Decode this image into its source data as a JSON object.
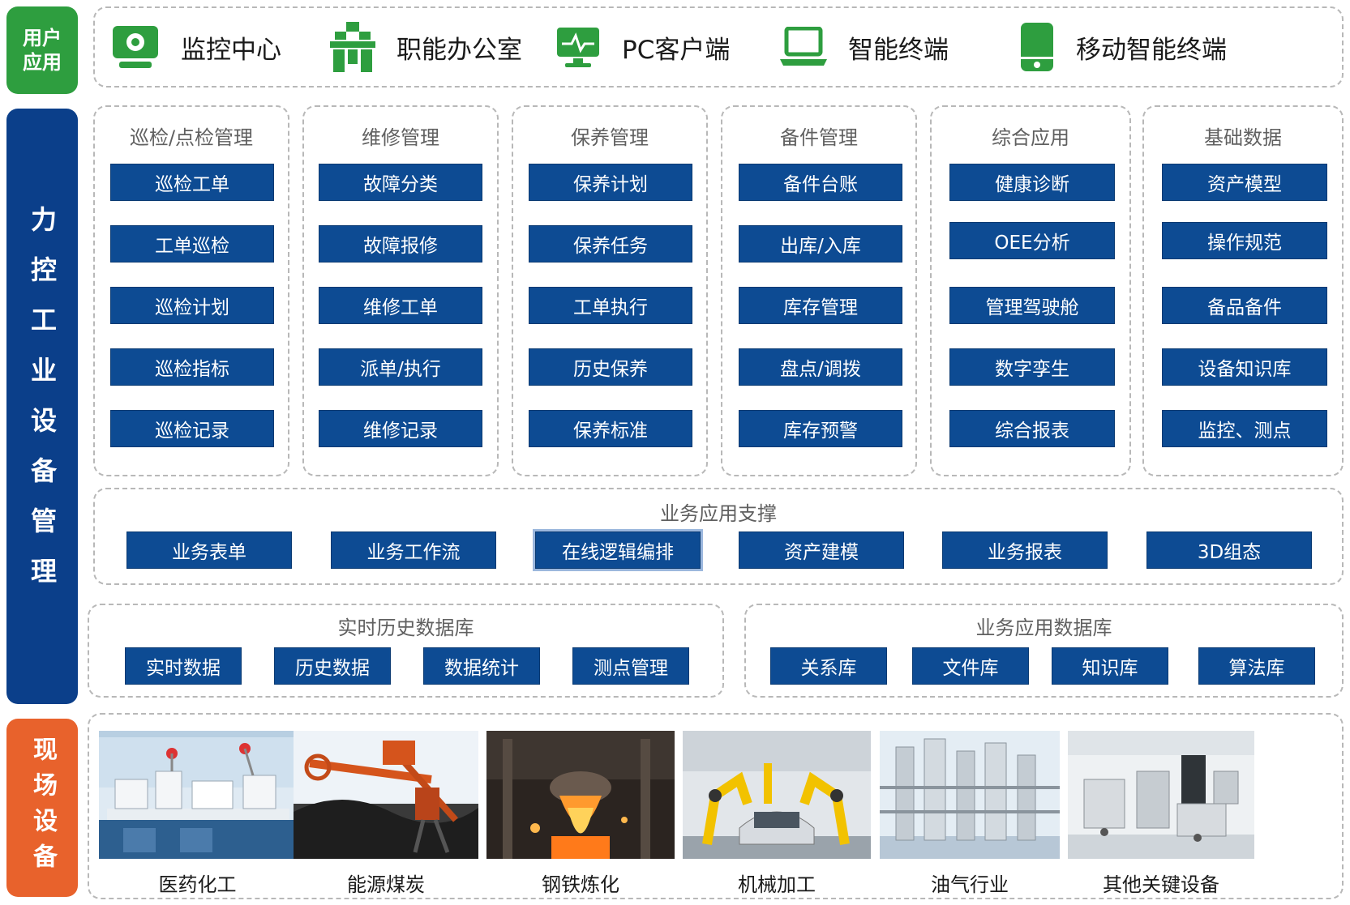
{
  "sections": {
    "user_app": "用户应用",
    "main": "力控工业设备管理",
    "field": "现场设备"
  },
  "top": [
    {
      "label": "监控中心",
      "icon": "monitor-center-icon"
    },
    {
      "label": "职能办公室",
      "icon": "office-icon"
    },
    {
      "label": "PC客户端",
      "icon": "pc-client-icon"
    },
    {
      "label": "智能终端",
      "icon": "laptop-icon"
    },
    {
      "label": "移动智能终端",
      "icon": "mobile-icon"
    }
  ],
  "modules": [
    {
      "title": "巡检/点检管理",
      "items": [
        "巡检工单",
        "工单巡检",
        "巡检计划",
        "巡检指标",
        "巡检记录"
      ]
    },
    {
      "title": "维修管理",
      "items": [
        "故障分类",
        "故障报修",
        "维修工单",
        "派单/执行",
        "维修记录"
      ]
    },
    {
      "title": "保养管理",
      "items": [
        "保养计划",
        "保养任务",
        "工单执行",
        "历史保养",
        "保养标准"
      ]
    },
    {
      "title": "备件管理",
      "items": [
        "备件台账",
        "出库/入库",
        "库存管理",
        "盘点/调拨",
        "库存预警"
      ]
    },
    {
      "title": "综合应用",
      "items": [
        "健康诊断",
        "OEE分析",
        "管理驾驶舱",
        "数字孪生",
        "综合报表"
      ]
    },
    {
      "title": "基础数据",
      "items": [
        "资产模型",
        "操作规范",
        "备品备件",
        "设备知识库",
        "监控、测点"
      ]
    }
  ],
  "support": {
    "title": "业务应用支撑",
    "items": [
      "业务表单",
      "业务工作流",
      "在线逻辑编排",
      "资产建模",
      "业务报表",
      "3D组态"
    ]
  },
  "realtime_db": {
    "title": "实时历史数据库",
    "items": [
      "实时数据",
      "历史数据",
      "数据统计",
      "测点管理"
    ]
  },
  "business_db": {
    "title": "业务应用数据库",
    "items": [
      "关系库",
      "文件库",
      "知识库",
      "算法库"
    ]
  },
  "industries": [
    "医药化工",
    "能源煤炭",
    "钢铁炼化",
    "机械加工",
    "油气行业",
    "其他关键设备"
  ],
  "colors": {
    "green": "#2e9e3f",
    "navy": "#0b3f8a",
    "button_blue": "#0d4b93",
    "orange": "#e8622c"
  }
}
